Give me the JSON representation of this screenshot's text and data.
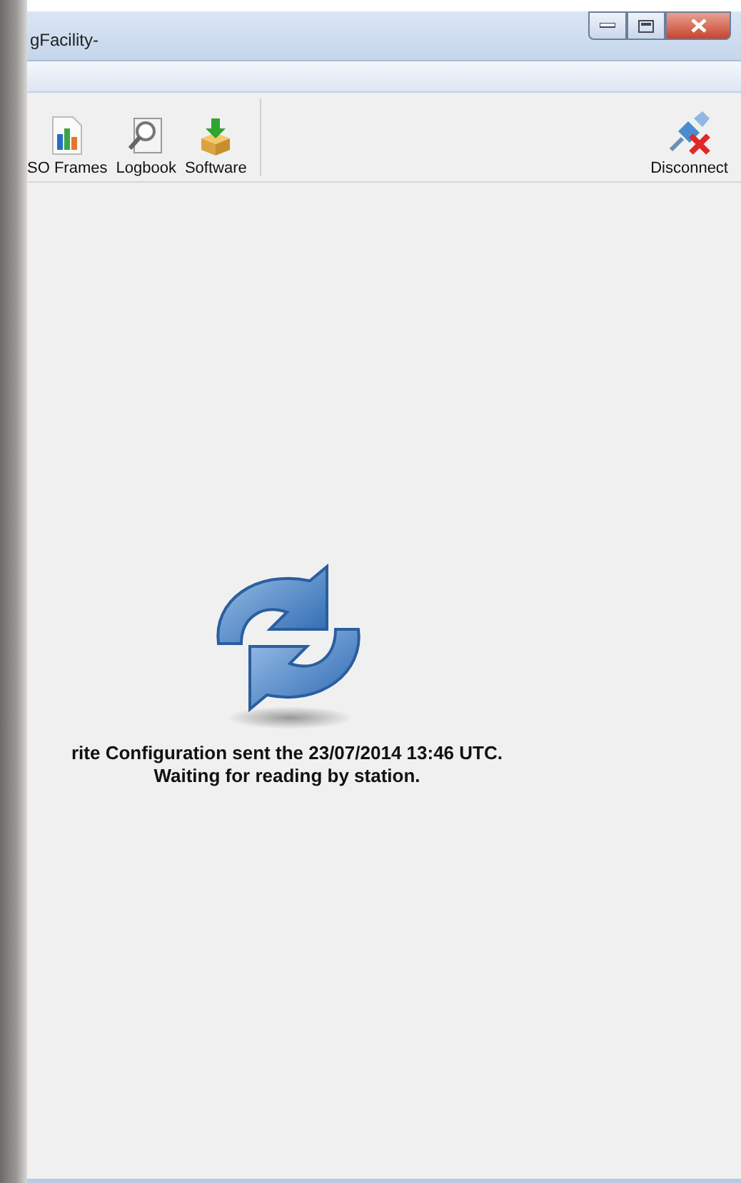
{
  "window": {
    "title": "gFacility-"
  },
  "toolbar": {
    "items": [
      {
        "label": "SO Frames",
        "kind": "frames"
      },
      {
        "label": "Logbook",
        "kind": "logbook"
      },
      {
        "label": "Software",
        "kind": "software"
      }
    ],
    "right_items": [
      {
        "label": "Disconnect",
        "kind": "disconnect"
      }
    ]
  },
  "status": {
    "lines": [
      "rite Configuration sent the 23/07/2014 13:46 UTC.",
      "Waiting for reading by station."
    ]
  }
}
